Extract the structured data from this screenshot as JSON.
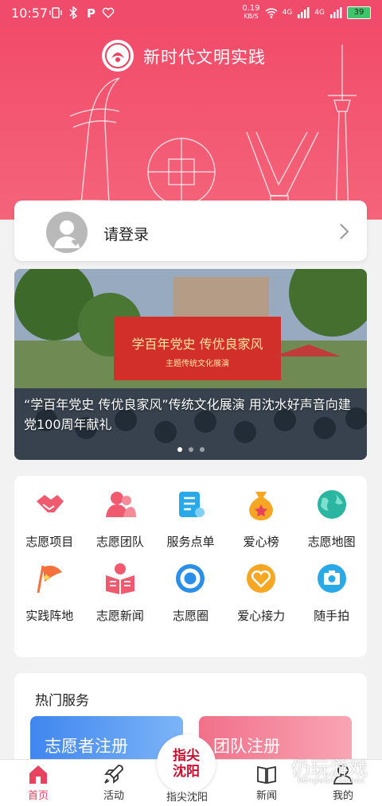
{
  "status_bar": {
    "time": "10:57",
    "speed_value": "0.19",
    "speed_unit": "KB/S",
    "network": "4G",
    "network2": "4G",
    "battery": "39"
  },
  "header": {
    "title": "新时代文明实践"
  },
  "login": {
    "label": "请登录"
  },
  "carousel": {
    "caption": "“学百年党史 传优良家风”传统文化展演 用沈水好声音向建党100周年献礼",
    "stage_text": "学百年党史 传优良家风",
    "stage_sub": "主题传统文化展演"
  },
  "grid": {
    "items": [
      {
        "label": "志愿项目",
        "icon": "handshake-icon",
        "color": "#f05a6e"
      },
      {
        "label": "志愿团队",
        "icon": "team-icon",
        "color": "#f05a6e"
      },
      {
        "label": "服务点单",
        "icon": "order-icon",
        "color": "#2aa9e8"
      },
      {
        "label": "爱心榜",
        "icon": "love-bag-icon",
        "color": "#f5a623"
      },
      {
        "label": "志愿地图",
        "icon": "globe-icon",
        "color": "#2ab6a0"
      },
      {
        "label": "实践阵地",
        "icon": "flag-icon",
        "color": "#f5703a"
      },
      {
        "label": "志愿新闻",
        "icon": "news-reader-icon",
        "color": "#f05a6e"
      },
      {
        "label": "志愿圈",
        "icon": "circle-icon",
        "color": "#2a8fe8"
      },
      {
        "label": "爱心接力",
        "icon": "heart-relay-icon",
        "color": "#f5a623"
      },
      {
        "label": "随手拍",
        "icon": "camera-icon",
        "color": "#2aa9e8"
      }
    ]
  },
  "hot_services": {
    "title": "热门服务",
    "volunteer_register": "志愿者注册",
    "team_register": "团队注册"
  },
  "bottom_nav": {
    "home": "首页",
    "activity": "活动",
    "center_line1": "指尖",
    "center_line2": "沈阳",
    "center_label": "指尖沈阳",
    "news": "新闻",
    "mine": "我的"
  },
  "watermark": {
    "text": "仍玩游戏",
    "sub": "Rengwan Games"
  },
  "colors": {
    "accent": "#f04b6b",
    "active_nav": "#e8425f"
  }
}
